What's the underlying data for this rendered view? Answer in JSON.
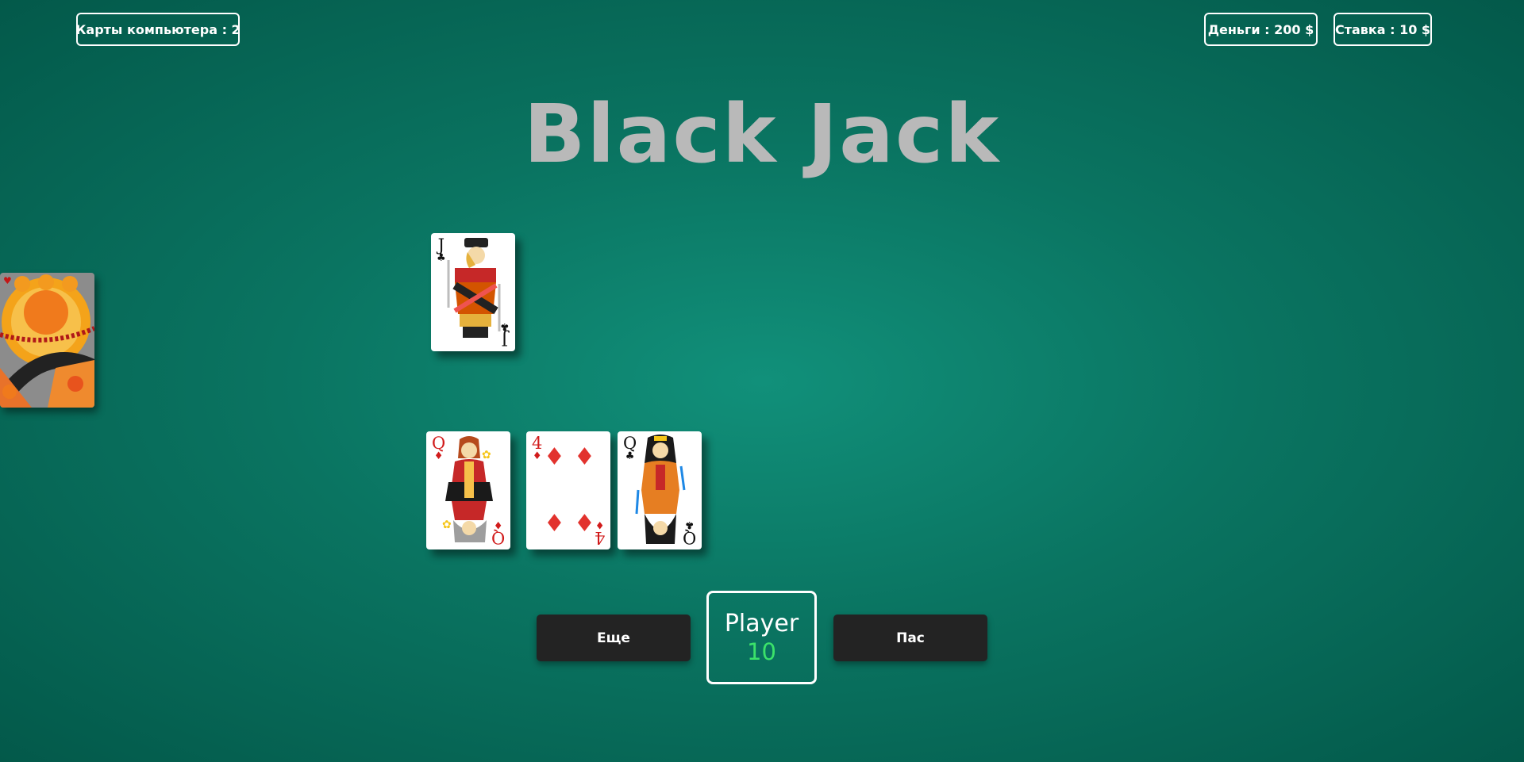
{
  "header": {
    "computer_cards_label": "Карты компьютера : 2",
    "money_label": "Деньги : 200 $",
    "bet_label": "Ставка : 10 $"
  },
  "title": "Black Jack",
  "dealer_hand": [
    {
      "rank": "J",
      "suit": "♣",
      "color": "black",
      "face": "jack"
    }
  ],
  "player_hand": [
    {
      "rank": "Q",
      "suit": "♦",
      "color": "red",
      "face": "queen-red"
    },
    {
      "rank": "4",
      "suit": "♦",
      "color": "red",
      "face": "pips"
    },
    {
      "rank": "Q",
      "suit": "♣",
      "color": "black",
      "face": "queen-black"
    }
  ],
  "controls": {
    "more_label": "Еще",
    "pass_label": "Пас"
  },
  "player": {
    "name": "Player",
    "score": "10"
  },
  "colors": {
    "table_center": "#11907a",
    "table_edge": "#03594a",
    "title": "#b9b9b9",
    "button_bg": "#232323",
    "score_green": "#3be26a"
  }
}
